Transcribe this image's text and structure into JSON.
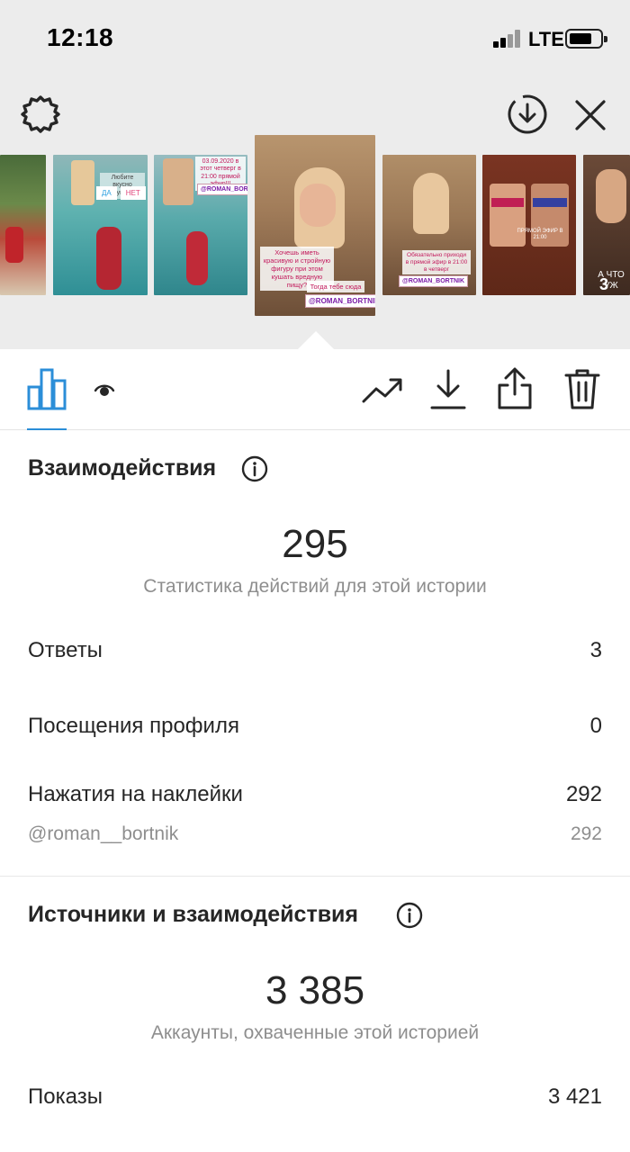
{
  "status_bar": {
    "time": "12:18",
    "network": "LTE"
  },
  "header": {
    "settings_icon": "gear-icon",
    "save_icon": "download-circle-icon",
    "close_icon": "close-icon"
  },
  "story_strip": {
    "thumbnails": [
      {
        "name": "story-thumb-1"
      },
      {
        "name": "story-thumb-2",
        "caption": "Любите вкусно покушать?",
        "poll_yes": "ДА",
        "poll_no": "НЕТ"
      },
      {
        "name": "story-thumb-3",
        "caption": "03.09.2020 в этот четверг в 21:00 прямой эфир!!!",
        "tag": "@ROMAN_BORTNIK"
      },
      {
        "name": "story-thumb-4",
        "caption": "Хочешь иметь красивую и стройную фигуру при этом кушать вредную пищу?",
        "caption2": "Тогда тебе сюда",
        "tag": "@ROMAN_BORTNIK"
      },
      {
        "name": "story-thumb-5",
        "caption": "Обязательно приходи в прямой эфир в 21:00 в четверг",
        "tag": "@ROMAN_BORTNIK"
      },
      {
        "name": "story-thumb-6",
        "caption": "ПРЯМОЙ ЭФИР В 21:00"
      },
      {
        "name": "story-thumb-7",
        "caption": "А ЧТО УЖ",
        "views": "3"
      }
    ]
  },
  "tabs": {
    "insights_icon": "bar-chart-icon",
    "viewers_icon": "eye-icon",
    "promote_icon": "trending-icon",
    "save_icon": "download-icon",
    "share_icon": "share-icon",
    "delete_icon": "trash-icon"
  },
  "interactions": {
    "title": "Взаимодействия",
    "total": "295",
    "total_caption": "Статистика действий для этой истории",
    "rows": [
      {
        "label": "Ответы",
        "value": "3"
      },
      {
        "label": "Посещения профиля",
        "value": "0"
      },
      {
        "label": "Нажатия на наклейки",
        "value": "292"
      }
    ],
    "sticker_handle": "@roman__bortnik",
    "sticker_handle_value": "292"
  },
  "discovery": {
    "title": "Источники и взаимодействия",
    "total": "3 385",
    "total_caption": "Аккаунты, охваченные этой историей",
    "rows": [
      {
        "label": "Показы",
        "value": "3 421"
      }
    ]
  },
  "colors": {
    "accent": "#2b8ed8",
    "text": "#262626",
    "muted": "#8e8e8e",
    "top_bg": "#ececec"
  }
}
